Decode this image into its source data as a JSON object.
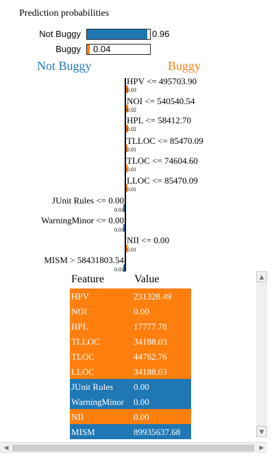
{
  "prediction": {
    "title": "Prediction probabilities",
    "rows": [
      {
        "label": "Not Buggy",
        "value_text": "0.96",
        "value": 0.96,
        "color": "#1f77b4"
      },
      {
        "label": "Buggy",
        "value_text": "0.04",
        "value": 0.04,
        "color": "#ff7f0e"
      }
    ]
  },
  "classes": {
    "negative": "Not Buggy",
    "positive": "Buggy"
  },
  "contributions": [
    {
      "rule": "HPV <= 495703.90",
      "weight_text": "0.03",
      "weight": 0.03,
      "side": "Buggy"
    },
    {
      "rule": "NOI <= 540540.54",
      "weight_text": "0.02",
      "weight": 0.02,
      "side": "Buggy"
    },
    {
      "rule": "HPL <= 58412.70",
      "weight_text": "0.02",
      "weight": 0.02,
      "side": "Buggy"
    },
    {
      "rule": "TLLOC <= 85470.09",
      "weight_text": "0.01",
      "weight": 0.01,
      "side": "Buggy"
    },
    {
      "rule": "TLOC <= 74604.60",
      "weight_text": "0.01",
      "weight": 0.01,
      "side": "Buggy"
    },
    {
      "rule": "LLOC <= 85470.09",
      "weight_text": "0.01",
      "weight": 0.01,
      "side": "Buggy"
    },
    {
      "rule": "JUnit Rules <= 0.00",
      "weight_text": "0.01",
      "weight": 0.01,
      "side": "Not Buggy"
    },
    {
      "rule": "WarningMinor <= 0.00",
      "weight_text": "0.01",
      "weight": 0.01,
      "side": "Not Buggy"
    },
    {
      "rule": "NII <= 0.00",
      "weight_text": "0.01",
      "weight": 0.01,
      "side": "Buggy"
    },
    {
      "rule": "MISM > 58431803.54",
      "weight_text": "0.01",
      "weight": 0.01,
      "side": "Not Buggy"
    }
  ],
  "table": {
    "headers": {
      "feature": "Feature",
      "value": "Value"
    },
    "rows": [
      {
        "feature": "HPV",
        "value": "231328.49",
        "color": "#ff7f0e"
      },
      {
        "feature": "NOI",
        "value": "0.00",
        "color": "#ff7f0e"
      },
      {
        "feature": "HPL",
        "value": "17777.78",
        "color": "#ff7f0e"
      },
      {
        "feature": "TLLOC",
        "value": "34188.03",
        "color": "#ff7f0e"
      },
      {
        "feature": "TLOC",
        "value": "44762.76",
        "color": "#ff7f0e"
      },
      {
        "feature": "LLOC",
        "value": "34188.03",
        "color": "#ff7f0e"
      },
      {
        "feature": "JUnit Rules",
        "value": "0.00",
        "color": "#1f77b4"
      },
      {
        "feature": "WarningMinor",
        "value": "0.00",
        "color": "#1f77b4"
      },
      {
        "feature": "NII",
        "value": "0.00",
        "color": "#ff7f0e"
      },
      {
        "feature": "MISM",
        "value": "89935637.68",
        "color": "#1f77b4"
      }
    ]
  }
}
